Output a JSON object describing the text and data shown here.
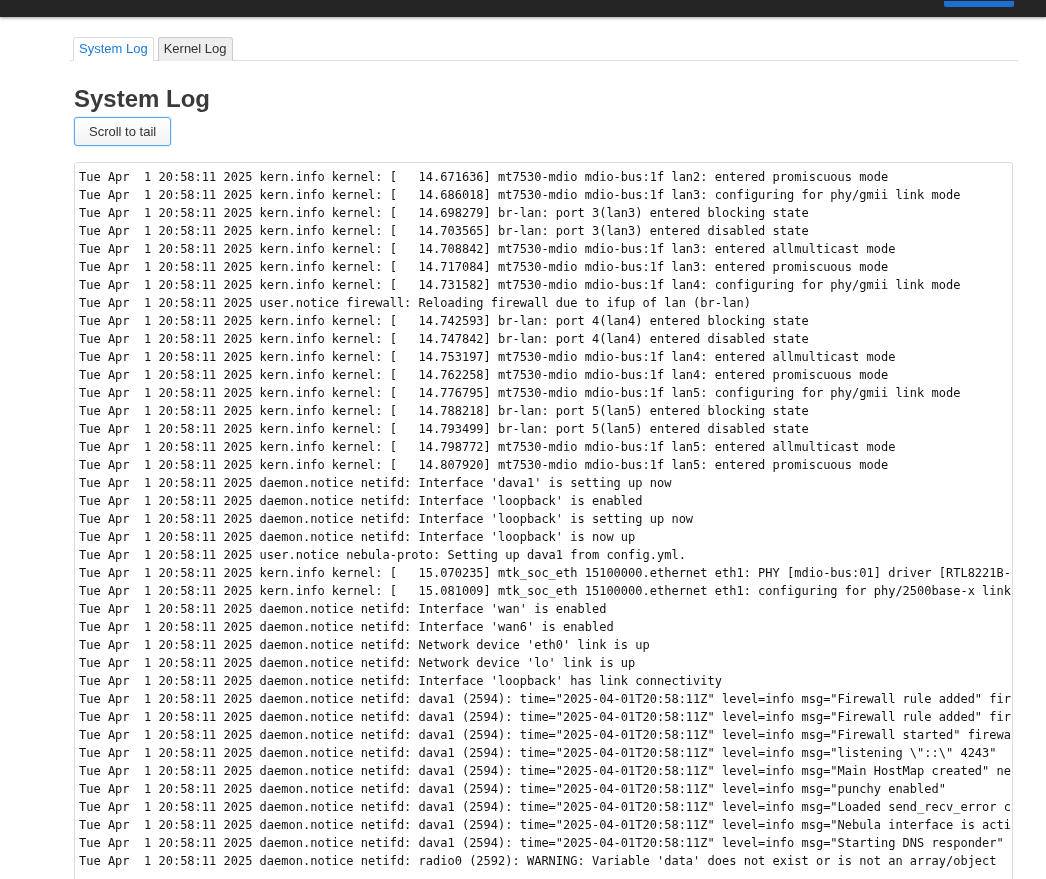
{
  "tabs": [
    {
      "label": "System Log",
      "selected": true
    },
    {
      "label": "Kernel Log",
      "selected": false
    }
  ],
  "heading": "System Log",
  "scroll_button": "Scroll to tail",
  "log_lines": [
    "Tue Apr  1 20:58:11 2025 kern.info kernel: [   14.671636] mt7530-mdio mdio-bus:1f lan2: entered promiscuous mode",
    "Tue Apr  1 20:58:11 2025 kern.info kernel: [   14.686018] mt7530-mdio mdio-bus:1f lan3: configuring for phy/gmii link mode",
    "Tue Apr  1 20:58:11 2025 kern.info kernel: [   14.698279] br-lan: port 3(lan3) entered blocking state",
    "Tue Apr  1 20:58:11 2025 kern.info kernel: [   14.703565] br-lan: port 3(lan3) entered disabled state",
    "Tue Apr  1 20:58:11 2025 kern.info kernel: [   14.708842] mt7530-mdio mdio-bus:1f lan3: entered allmulticast mode",
    "Tue Apr  1 20:58:11 2025 kern.info kernel: [   14.717084] mt7530-mdio mdio-bus:1f lan3: entered promiscuous mode",
    "Tue Apr  1 20:58:11 2025 kern.info kernel: [   14.731582] mt7530-mdio mdio-bus:1f lan4: configuring for phy/gmii link mode",
    "Tue Apr  1 20:58:11 2025 user.notice firewall: Reloading firewall due to ifup of lan (br-lan)",
    "Tue Apr  1 20:58:11 2025 kern.info kernel: [   14.742593] br-lan: port 4(lan4) entered blocking state",
    "Tue Apr  1 20:58:11 2025 kern.info kernel: [   14.747842] br-lan: port 4(lan4) entered disabled state",
    "Tue Apr  1 20:58:11 2025 kern.info kernel: [   14.753197] mt7530-mdio mdio-bus:1f lan4: entered allmulticast mode",
    "Tue Apr  1 20:58:11 2025 kern.info kernel: [   14.762258] mt7530-mdio mdio-bus:1f lan4: entered promiscuous mode",
    "Tue Apr  1 20:58:11 2025 kern.info kernel: [   14.776795] mt7530-mdio mdio-bus:1f lan5: configuring for phy/gmii link mode",
    "Tue Apr  1 20:58:11 2025 kern.info kernel: [   14.788218] br-lan: port 5(lan5) entered blocking state",
    "Tue Apr  1 20:58:11 2025 kern.info kernel: [   14.793499] br-lan: port 5(lan5) entered disabled state",
    "Tue Apr  1 20:58:11 2025 kern.info kernel: [   14.798772] mt7530-mdio mdio-bus:1f lan5: entered allmulticast mode",
    "Tue Apr  1 20:58:11 2025 kern.info kernel: [   14.807920] mt7530-mdio mdio-bus:1f lan5: entered promiscuous mode",
    "Tue Apr  1 20:58:11 2025 daemon.notice netifd: Interface 'dava1' is setting up now",
    "Tue Apr  1 20:58:11 2025 daemon.notice netifd: Interface 'loopback' is enabled",
    "Tue Apr  1 20:58:11 2025 daemon.notice netifd: Interface 'loopback' is setting up now",
    "Tue Apr  1 20:58:11 2025 daemon.notice netifd: Interface 'loopback' is now up",
    "Tue Apr  1 20:58:11 2025 user.notice nebula-proto: Setting up dava1 from config.yml.",
    "Tue Apr  1 20:58:11 2025 kern.info kernel: [   15.070235] mtk_soc_eth 15100000.ethernet eth1: PHY [mdio-bus:01] driver [RTL8221B-",
    "Tue Apr  1 20:58:11 2025 kern.info kernel: [   15.081009] mtk_soc_eth 15100000.ethernet eth1: configuring for phy/2500base-x link",
    "Tue Apr  1 20:58:11 2025 daemon.notice netifd: Interface 'wan' is enabled",
    "Tue Apr  1 20:58:11 2025 daemon.notice netifd: Interface 'wan6' is enabled",
    "Tue Apr  1 20:58:11 2025 daemon.notice netifd: Network device 'eth0' link is up",
    "Tue Apr  1 20:58:11 2025 daemon.notice netifd: Network device 'lo' link is up",
    "Tue Apr  1 20:58:11 2025 daemon.notice netifd: Interface 'loopback' has link connectivity",
    "Tue Apr  1 20:58:11 2025 daemon.notice netifd: dava1 (2594): time=\"2025-04-01T20:58:11Z\" level=info msg=\"Firewall rule added\" fir",
    "Tue Apr  1 20:58:11 2025 daemon.notice netifd: dava1 (2594): time=\"2025-04-01T20:58:11Z\" level=info msg=\"Firewall rule added\" fir",
    "Tue Apr  1 20:58:11 2025 daemon.notice netifd: dava1 (2594): time=\"2025-04-01T20:58:11Z\" level=info msg=\"Firewall started\" firewa",
    "Tue Apr  1 20:58:11 2025 daemon.notice netifd: dava1 (2594): time=\"2025-04-01T20:58:11Z\" level=info msg=\"listening \\\"::\\\" 4243\"",
    "Tue Apr  1 20:58:11 2025 daemon.notice netifd: dava1 (2594): time=\"2025-04-01T20:58:11Z\" level=info msg=\"Main HostMap created\" ne",
    "Tue Apr  1 20:58:11 2025 daemon.notice netifd: dava1 (2594): time=\"2025-04-01T20:58:11Z\" level=info msg=\"punchy enabled\"",
    "Tue Apr  1 20:58:11 2025 daemon.notice netifd: dava1 (2594): time=\"2025-04-01T20:58:11Z\" level=info msg=\"Loaded send_recv_error c",
    "Tue Apr  1 20:58:11 2025 daemon.notice netifd: dava1 (2594): time=\"2025-04-01T20:58:11Z\" level=info msg=\"Nebula interface is acti",
    "Tue Apr  1 20:58:11 2025 daemon.notice netifd: dava1 (2594): time=\"2025-04-01T20:58:11Z\" level=info msg=\"Starting DNS responder\"",
    "Tue Apr  1 20:58:11 2025 daemon.notice netifd: radio0 (2592): WARNING: Variable 'data' does not exist or is not an array/object"
  ]
}
